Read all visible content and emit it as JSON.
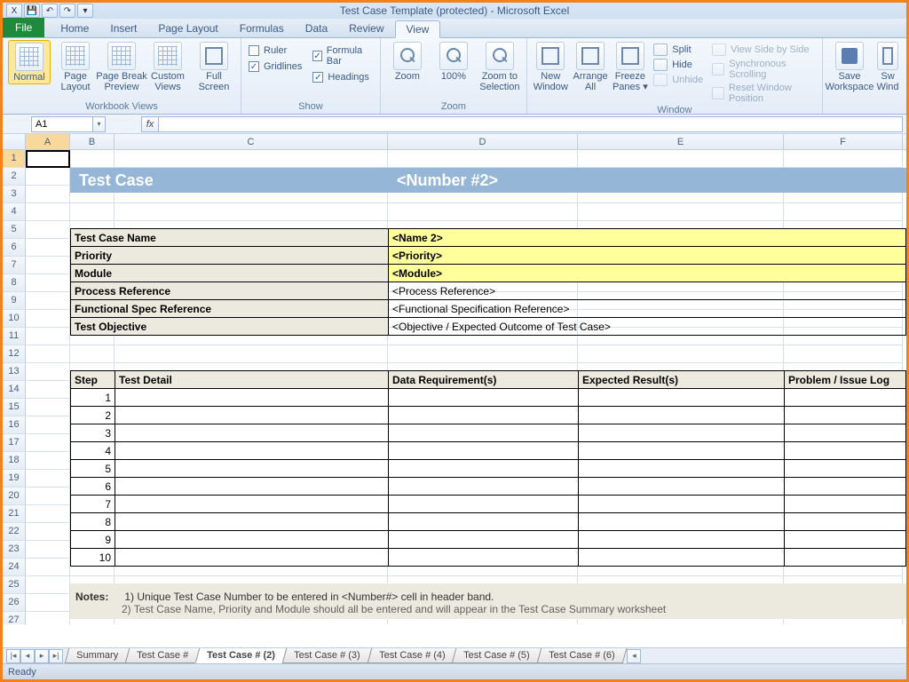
{
  "window": {
    "title": "Test Case Template (protected)  -  Microsoft Excel"
  },
  "qat": {
    "save": "💾",
    "undo": "↶",
    "redo": "↷"
  },
  "tabs": {
    "file": "File",
    "items": [
      "Home",
      "Insert",
      "Page Layout",
      "Formulas",
      "Data",
      "Review",
      "View"
    ],
    "active": "View"
  },
  "ribbon": {
    "views": {
      "label": "Workbook Views",
      "normal": "Normal",
      "page_layout": "Page\nLayout",
      "page_break": "Page Break\nPreview",
      "custom": "Custom\nViews",
      "full_screen": "Full\nScreen"
    },
    "show": {
      "label": "Show",
      "ruler": "Ruler",
      "formula_bar": "Formula Bar",
      "gridlines": "Gridlines",
      "headings": "Headings"
    },
    "zoom": {
      "label": "Zoom",
      "zoom_btn": "Zoom",
      "hundred": "100%",
      "zoom_sel": "Zoom to\nSelection"
    },
    "window": {
      "label": "Window",
      "new_win": "New\nWindow",
      "arrange": "Arrange\nAll",
      "freeze": "Freeze\nPanes ▾",
      "split": "Split",
      "hide": "Hide",
      "unhide": "Unhide",
      "side": "View Side by Side",
      "sync": "Synchronous Scrolling",
      "reset": "Reset Window Position"
    },
    "macros": {
      "save_ws": "Save\nWorkspace",
      "switch": "Sw\nWind"
    }
  },
  "namebox": {
    "value": "A1"
  },
  "fx_label": "fx",
  "columns": [
    "A",
    "B",
    "C",
    "D",
    "E",
    "F"
  ],
  "row_numbers": [
    1,
    2,
    3,
    4,
    5,
    6,
    7,
    8,
    9,
    10,
    11,
    12,
    13,
    14,
    15,
    16,
    17,
    18,
    19,
    20,
    21,
    22,
    23,
    24,
    25,
    26,
    27
  ],
  "band": {
    "label": "Test Case",
    "number": "<Number #2>"
  },
  "info": [
    {
      "key": "Test Case Name",
      "val": "<Name 2>",
      "yellow": true
    },
    {
      "key": "Priority",
      "val": "<Priority>",
      "yellow": true
    },
    {
      "key": "Module",
      "val": "<Module>",
      "yellow": true
    },
    {
      "key": "Process Reference",
      "val": "<Process Reference>",
      "yellow": false
    },
    {
      "key": "Functional Spec Reference",
      "val": "<Functional Specification Reference>",
      "yellow": false
    },
    {
      "key": "Test Objective",
      "val": "<Objective / Expected Outcome of Test Case>",
      "yellow": false
    }
  ],
  "steps_header": {
    "step": "Step",
    "detail": "Test Detail",
    "data": "Data Requirement(s)",
    "exp": "Expected Result(s)",
    "prob": "Problem / Issue Log"
  },
  "steps": [
    1,
    2,
    3,
    4,
    5,
    6,
    7,
    8,
    9,
    10
  ],
  "notes": {
    "label": "Notes:",
    "n1": "1) Unique Test Case Number to be entered in <Number#> cell in header band.",
    "n2": "2) Test Case Name, Priority and Module should all be entered and will appear in the Test Case Summary worksheet"
  },
  "sheet_tabs": [
    "Summary",
    "Test Case #",
    "Test Case # (2)",
    "Test Case # (3)",
    "Test Case # (4)",
    "Test Case # (5)",
    "Test Case # (6)"
  ],
  "active_sheet": "Test Case # (2)",
  "status": {
    "ready": "Ready"
  }
}
